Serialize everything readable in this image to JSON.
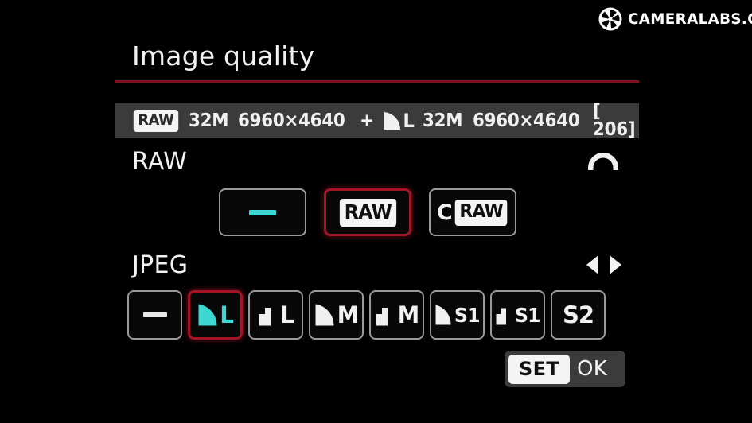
{
  "watermark": {
    "text": "CAMERALABS.COM",
    "logo_icon": "aperture-icon"
  },
  "header": {
    "title": "Image quality",
    "accent_color": "#7d1020"
  },
  "info_bar": {
    "raw_badge": "RAW",
    "raw_size": "32M",
    "raw_dimensions": "6960×4640",
    "plus": "+",
    "jpeg_quality_icon": "fine-arc-icon",
    "jpeg_letter": "L",
    "jpeg_size": "32M",
    "jpeg_dimensions": "6960×4640",
    "remaining_shots": "[ 206]"
  },
  "raw_section": {
    "label": "RAW",
    "dial_icon": "main-dial-icon",
    "options": [
      {
        "name": "raw-off",
        "type": "dash",
        "label": "—",
        "selected": false,
        "highlight": true
      },
      {
        "name": "raw",
        "type": "badge",
        "label": "RAW",
        "selected": true,
        "highlight": false
      },
      {
        "name": "craw",
        "type": "craw",
        "prefix": "C",
        "label": "RAW",
        "selected": false,
        "highlight": false
      }
    ]
  },
  "jpeg_section": {
    "label": "JPEG",
    "arrows_icon": "left-right-arrows-icon",
    "options": [
      {
        "name": "jpeg-off",
        "type": "dash",
        "label": "—",
        "icon": "",
        "letter": "",
        "selected": false,
        "highlight": false
      },
      {
        "name": "jpeg-large-fine",
        "type": "quality",
        "icon": "fine-arc-icon",
        "letter": "L",
        "selected": true,
        "highlight": true
      },
      {
        "name": "jpeg-large-normal",
        "type": "quality",
        "icon": "normal-step-icon",
        "letter": "L",
        "selected": false,
        "highlight": false
      },
      {
        "name": "jpeg-medium-fine",
        "type": "quality",
        "icon": "fine-arc-icon",
        "letter": "M",
        "selected": false,
        "highlight": false
      },
      {
        "name": "jpeg-medium-normal",
        "type": "quality",
        "icon": "normal-step-icon",
        "letter": "M",
        "selected": false,
        "highlight": false
      },
      {
        "name": "jpeg-small1-fine",
        "type": "quality",
        "icon": "fine-arc-icon",
        "letter": "S1",
        "selected": false,
        "highlight": false
      },
      {
        "name": "jpeg-small1-normal",
        "type": "quality",
        "icon": "normal-step-icon",
        "letter": "S1",
        "selected": false,
        "highlight": false
      },
      {
        "name": "jpeg-small2",
        "type": "letter",
        "icon": "",
        "letter": "S2",
        "selected": false,
        "highlight": false
      }
    ]
  },
  "footer": {
    "set_label": "SET",
    "ok_label": "OK"
  },
  "colors": {
    "background": "#000000",
    "panel": "#3b3b3b",
    "accent_red": "#a51328",
    "highlight_cyan": "#3ed8d2",
    "text": "#f2f2f2"
  }
}
